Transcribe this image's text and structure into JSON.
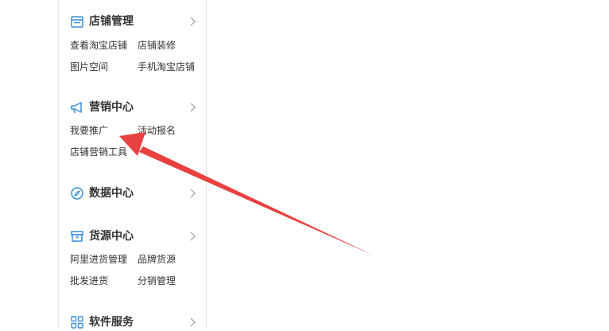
{
  "accent_color": "#3a8fd9",
  "annotation_color": "#e8413f",
  "sections": [
    {
      "title": "店铺管理",
      "icon": "store-icon",
      "links": [
        "查看淘宝店铺",
        "店铺装修",
        "图片空间",
        "手机淘宝店铺"
      ]
    },
    {
      "title": "营销中心",
      "icon": "megaphone-icon",
      "links": [
        "我要推广",
        "活动报名",
        "店铺营销工具"
      ]
    },
    {
      "title": "数据中心",
      "icon": "compass-icon",
      "links": []
    },
    {
      "title": "货源中心",
      "icon": "box-icon",
      "links": [
        "阿里进货管理",
        "品牌货源",
        "批发进货",
        "分销管理"
      ]
    },
    {
      "title": "软件服务",
      "icon": "apps-grid-icon",
      "links": []
    }
  ]
}
